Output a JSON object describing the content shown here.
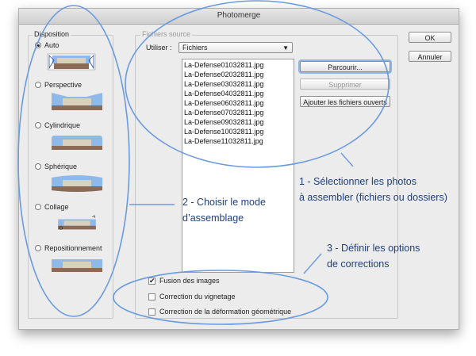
{
  "window": {
    "title": "Photomerge"
  },
  "layout": {
    "legend": "Disposition",
    "options": [
      {
        "label": "Auto",
        "selected": true
      },
      {
        "label": "Perspective",
        "selected": false
      },
      {
        "label": "Cylindrique",
        "selected": false
      },
      {
        "label": "Sphérique",
        "selected": false
      },
      {
        "label": "Collage",
        "selected": false
      },
      {
        "label": "Repositionnement",
        "selected": false
      }
    ]
  },
  "source": {
    "legend": "Fichiers source",
    "use_label": "Utiliser :",
    "use_value": "Fichiers",
    "files": [
      "La-Defense01032811.jpg",
      "La-Defense02032811.jpg",
      "La-Defense03032811.jpg",
      "La-Defense04032811.jpg",
      "La-Defense06032811.jpg",
      "La-Defense07032811.jpg",
      "La-Defense09032811.jpg",
      "La-Defense10032811.jpg",
      "La-Defense11032811.jpg"
    ],
    "browse_label": "Parcourir...",
    "remove_label": "Supprimer",
    "add_open_label": "Ajouter les fichiers ouverts"
  },
  "buttons": {
    "ok": "OK",
    "cancel": "Annuler"
  },
  "options": [
    {
      "label": "Fusion des images",
      "checked": true
    },
    {
      "label": "Correction du vignetage",
      "checked": false
    },
    {
      "label": "Correction de la déformation géométrique",
      "checked": false
    }
  ],
  "annotations": {
    "a1_line1": "1 - Sélectionner les photos",
    "a1_line2": "à assembler (fichiers ou dossiers)",
    "a2_line1": "2 - Choisir le mode",
    "a2_line2": "d’assemblage",
    "a3_line1": "3 - Définir les options",
    "a3_line2": "de corrections"
  },
  "colors": {
    "annotation": "#6a9ae0",
    "annotation_text": "#1f3f7a",
    "focus": "#8db6e8"
  }
}
